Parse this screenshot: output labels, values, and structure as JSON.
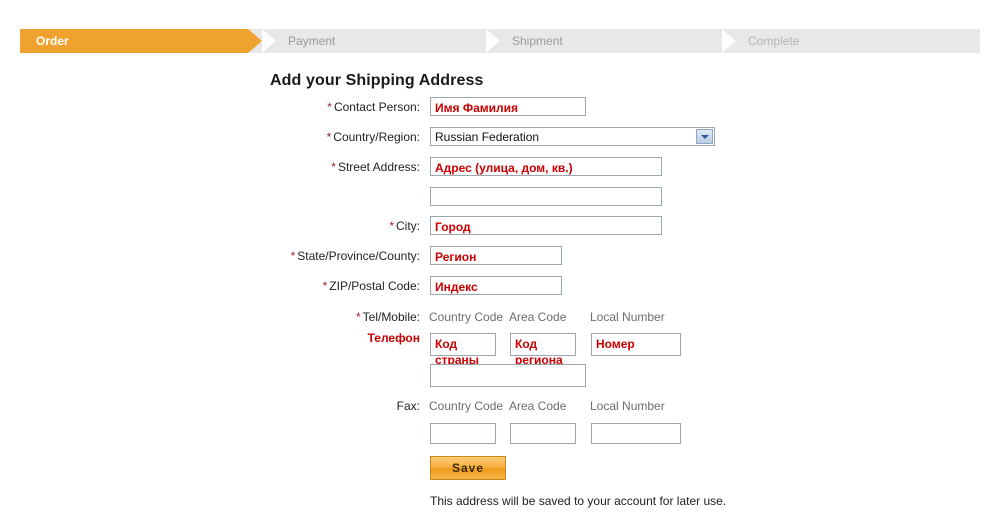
{
  "steps": [
    {
      "label": "Order",
      "state": "active"
    },
    {
      "label": "Payment",
      "state": "inactive"
    },
    {
      "label": "Shipment",
      "state": "inactive"
    },
    {
      "label": "Complete",
      "state": "dim"
    }
  ],
  "colors": {
    "accent": "#efa32e",
    "bar_bg": "#e8e8e8",
    "required_mark": "#9c1f1f",
    "value_text": "#cc0000",
    "input_border": "#9aa7b0"
  },
  "form": {
    "title": "Add your Shipping Address",
    "required_mark": "*",
    "fields": {
      "contact_person": {
        "label": "Contact Person:",
        "value": "Имя Фамилия",
        "placeholder": ""
      },
      "country_region": {
        "label": "Country/Region:",
        "selected": "Russian Federation"
      },
      "street_address": {
        "label": "Street Address:",
        "value_line1": "Адрес (улица, дом, кв.)",
        "value_line2": ""
      },
      "city": {
        "label": "City:",
        "value": "Город"
      },
      "state_province": {
        "label": "State/Province/County:",
        "value": "Регион"
      },
      "zip": {
        "label": "ZIP/Postal Code:",
        "value": "Индекс"
      },
      "tel": {
        "label": "Tel/Mobile:",
        "sub_label": "Телефон",
        "col_country": "Country Code",
        "col_area": "Area Code",
        "col_local": "Local Number",
        "value_country": "Код страны",
        "value_area": "Код региона",
        "value_local": "Номер",
        "value_extra": ""
      },
      "fax": {
        "label": "Fax:",
        "col_country": "Country Code",
        "col_area": "Area Code",
        "col_local": "Local Number",
        "value_country": "",
        "value_area": "",
        "value_local": ""
      }
    },
    "save_label": "Save",
    "footnote": "This address will be saved to your account for later use."
  }
}
